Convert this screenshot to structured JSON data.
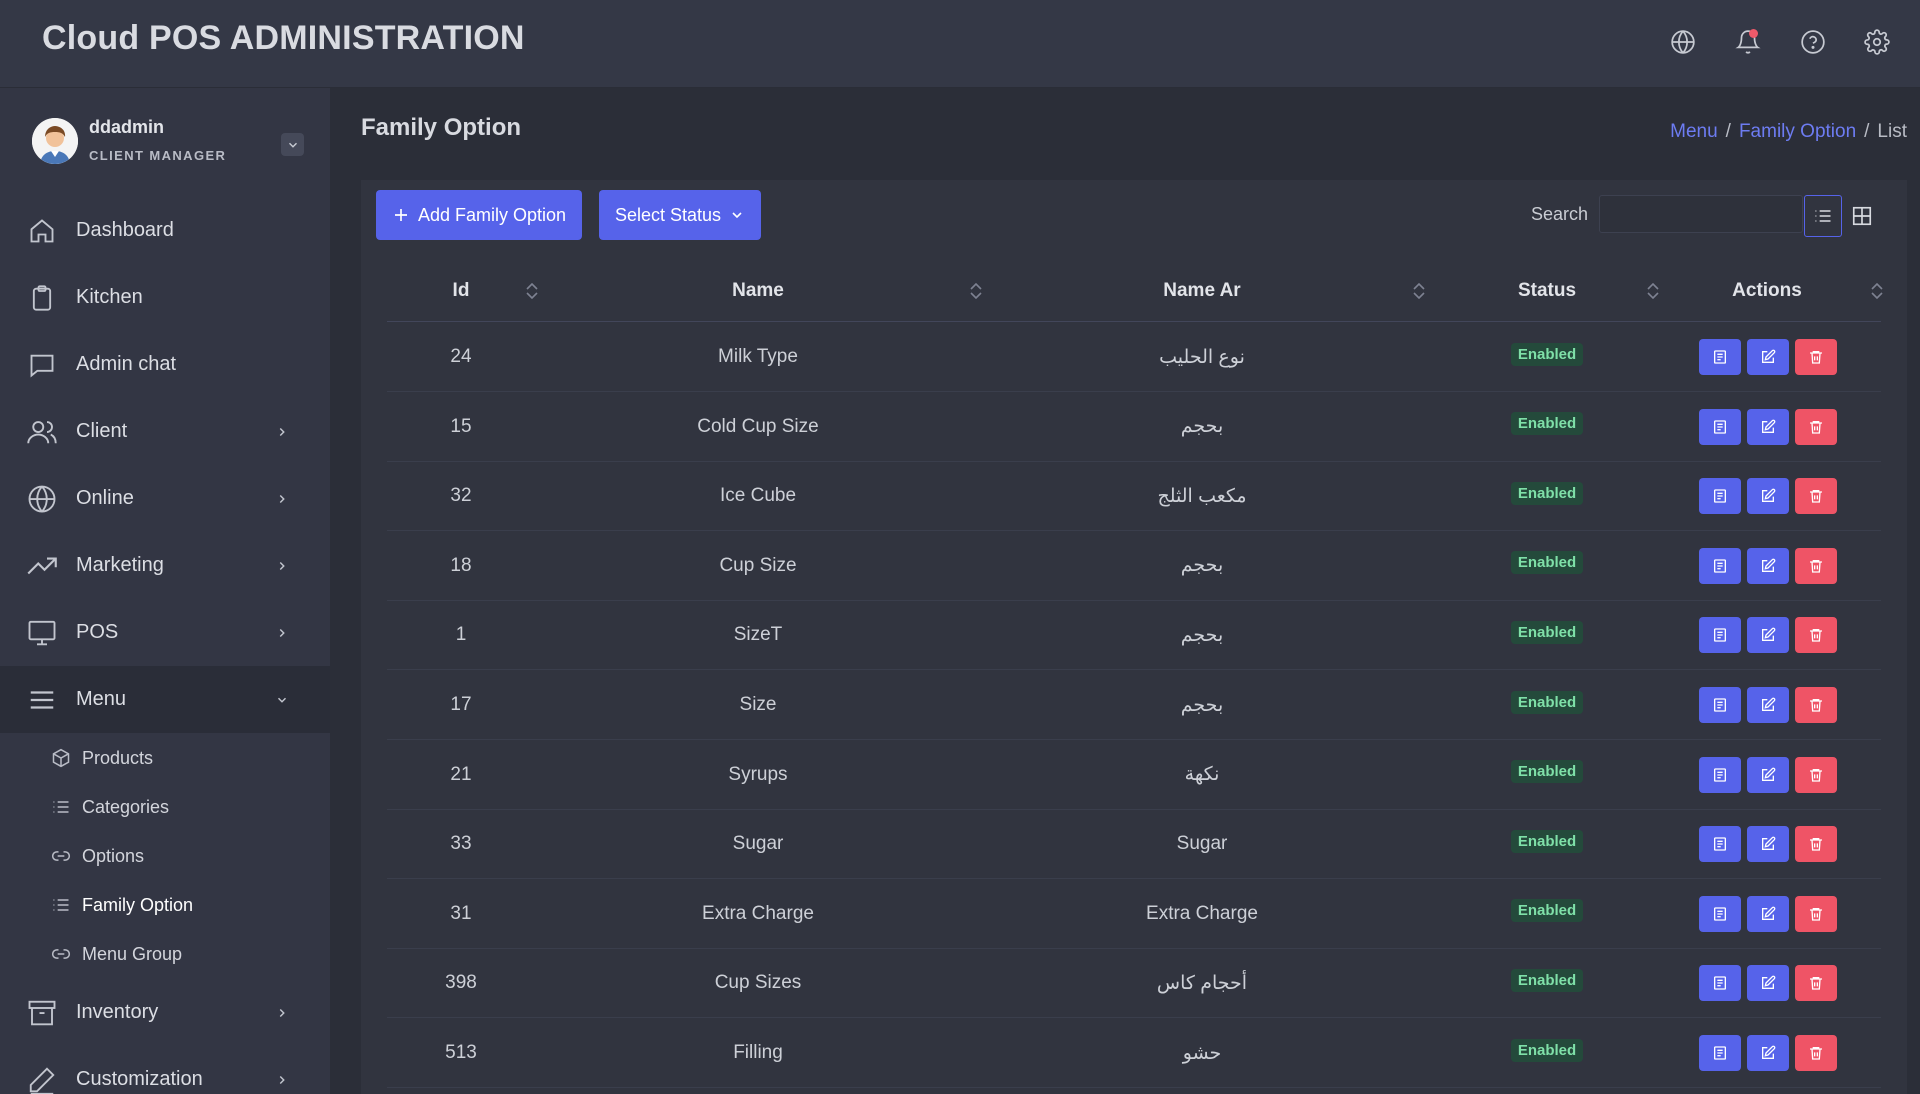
{
  "app": {
    "title": "Cloud POS ADMINISTRATION"
  },
  "topbar": {
    "icons": [
      "globe-icon",
      "bell-icon",
      "help-icon",
      "gear-icon"
    ]
  },
  "user": {
    "name": "ddadmin",
    "role": "CLIENT MANAGER"
  },
  "sidebar": {
    "items": [
      {
        "label": "Dashboard",
        "icon": "home-icon"
      },
      {
        "label": "Kitchen",
        "icon": "clipboard-icon"
      },
      {
        "label": "Admin chat",
        "icon": "chat-icon"
      },
      {
        "label": "Client",
        "icon": "users-icon"
      },
      {
        "label": "Online",
        "icon": "globe-icon"
      },
      {
        "label": "Marketing",
        "icon": "trend-icon"
      },
      {
        "label": "POS",
        "icon": "monitor-icon"
      },
      {
        "label": "Menu",
        "icon": "menu-icon"
      },
      {
        "label": "Inventory",
        "icon": "archive-icon"
      },
      {
        "label": "Customization",
        "icon": "pen-icon"
      }
    ],
    "menu_sub": [
      {
        "label": "Products",
        "icon": "box-icon"
      },
      {
        "label": "Categories",
        "icon": "list-icon"
      },
      {
        "label": "Options",
        "icon": "link-icon"
      },
      {
        "label": "Family Option",
        "icon": "list-icon"
      },
      {
        "label": "Menu Group",
        "icon": "link-icon"
      }
    ]
  },
  "page": {
    "title": "Family Option",
    "breadcrumb": [
      "Menu",
      "Family Option",
      "List"
    ]
  },
  "toolbar": {
    "add_label": "Add Family Option",
    "status_label": "Select Status",
    "search_label": "Search",
    "search_value": ""
  },
  "table": {
    "columns": [
      "Id",
      "Name",
      "Name Ar",
      "Status",
      "Actions"
    ],
    "rows": [
      {
        "id": "24",
        "name": "Milk Type",
        "name_ar": "نوع الحليب",
        "status": "Enabled"
      },
      {
        "id": "15",
        "name": "Cold Cup Size",
        "name_ar": "بحجم",
        "status": "Enabled"
      },
      {
        "id": "32",
        "name": "Ice Cube",
        "name_ar": "مكعب الثلج",
        "status": "Enabled"
      },
      {
        "id": "18",
        "name": "Cup Size",
        "name_ar": "بحجم",
        "status": "Enabled"
      },
      {
        "id": "1",
        "name": "SizeT",
        "name_ar": "بحجم",
        "status": "Enabled"
      },
      {
        "id": "17",
        "name": "Size",
        "name_ar": "بحجم",
        "status": "Enabled"
      },
      {
        "id": "21",
        "name": "Syrups",
        "name_ar": "نكهة",
        "status": "Enabled"
      },
      {
        "id": "33",
        "name": "Sugar",
        "name_ar": "Sugar",
        "status": "Enabled"
      },
      {
        "id": "31",
        "name": "Extra Charge",
        "name_ar": "Extra Charge",
        "status": "Enabled"
      },
      {
        "id": "398",
        "name": "Cup Sizes",
        "name_ar": "أحجام كاس",
        "status": "Enabled"
      },
      {
        "id": "513",
        "name": "Filling",
        "name_ar": "حشو",
        "status": "Enabled"
      }
    ]
  },
  "colors": {
    "accent": "#5663ea",
    "danger": "#ef5466",
    "enabled_badge": "#7fe0a8"
  }
}
